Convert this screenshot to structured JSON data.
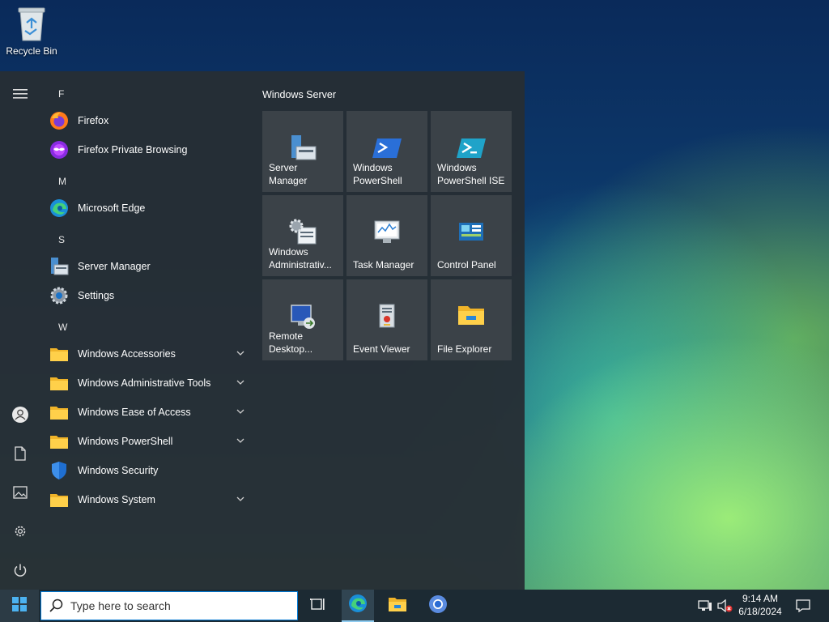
{
  "desktop": {
    "icons": [
      {
        "label": "Recycle Bin",
        "icon": "recycle-bin-icon"
      }
    ]
  },
  "start_menu": {
    "rail": {
      "items": [
        {
          "name": "hamburger-menu-icon"
        },
        {
          "name": "user-account-icon"
        },
        {
          "name": "documents-icon"
        },
        {
          "name": "pictures-icon"
        },
        {
          "name": "settings-gear-icon"
        },
        {
          "name": "power-icon"
        }
      ]
    },
    "groups": {
      "f": "F",
      "m": "M",
      "s": "S",
      "w": "W"
    },
    "apps": {
      "firefox": "Firefox",
      "firefox_private": "Firefox Private Browsing",
      "edge": "Microsoft Edge",
      "server_manager": "Server Manager",
      "settings": "Settings",
      "win_accessories": "Windows Accessories",
      "win_admin_tools": "Windows Administrative Tools",
      "win_ease": "Windows Ease of Access",
      "win_powershell": "Windows PowerShell",
      "win_security": "Windows Security",
      "win_system": "Windows System"
    },
    "tiles_title": "Windows Server",
    "tiles": {
      "server_manager": "Server Manager",
      "powershell": "Windows\nPowerShell",
      "powershell_ise": "Windows\nPowerShell ISE",
      "admin_tools": "Windows\nAdministrativ...",
      "task_manager": "Task Manager",
      "control_panel": "Control Panel",
      "remote_desktop": "Remote\nDesktop...",
      "event_viewer": "Event Viewer",
      "file_explorer": "File Explorer"
    }
  },
  "taskbar": {
    "search_placeholder": "Type here to search",
    "time": "9:14 AM",
    "date": "6/18/2024",
    "colors": {
      "accent": "#0078d4",
      "taskbar_bg": "#1c2a33"
    }
  }
}
